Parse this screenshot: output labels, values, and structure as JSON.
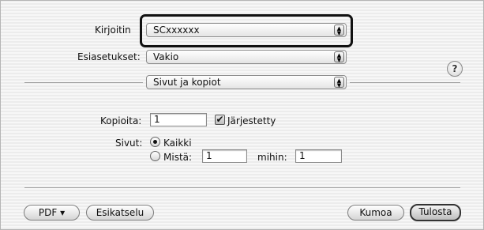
{
  "printer": {
    "label": "Kirjoitin",
    "value": "SCxxxxxx"
  },
  "presets": {
    "label": "Esiasetukset:",
    "value": "Vakio"
  },
  "panel": {
    "value": "Sivut ja kopiot"
  },
  "help": {
    "glyph": "?"
  },
  "copies": {
    "label": "Kopioita:",
    "value": "1",
    "collated_label": "Järjestetty",
    "collated_checked": true,
    "check_glyph": "✔"
  },
  "pages": {
    "label": "Sivut:",
    "all_label": "Kaikki",
    "all_selected": true,
    "from_label": "Mistä:",
    "from_value": "1",
    "to_label": "mihin:",
    "to_value": "1"
  },
  "buttons": {
    "pdf": "PDF ▾",
    "preview": "Esikatselu",
    "cancel": "Kumoa",
    "print": "Tulosta"
  },
  "icons": {
    "popup_arrows": "▲▼"
  }
}
